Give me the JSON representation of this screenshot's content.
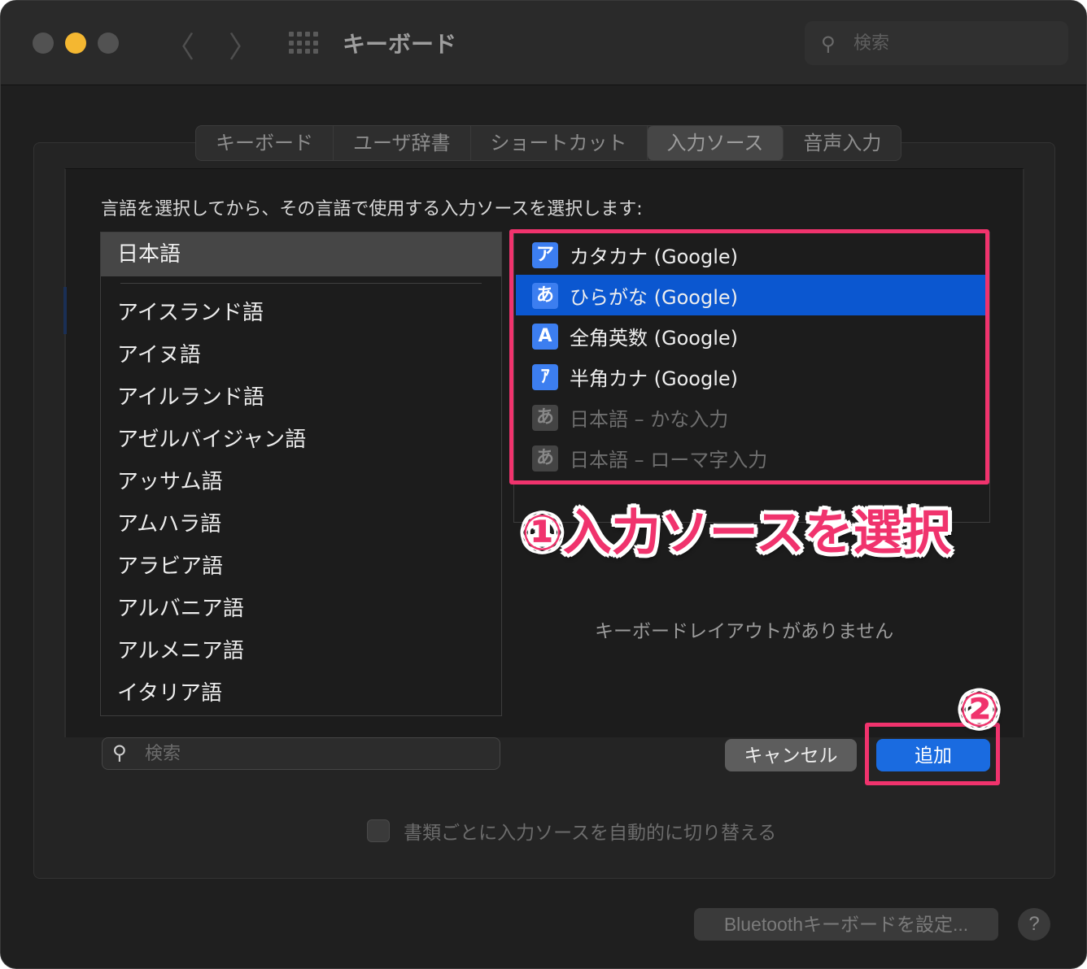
{
  "window": {
    "title": "キーボード",
    "search_placeholder": "検索",
    "nav_back_glyph": "〈",
    "nav_forward_glyph": "〉",
    "icons": [
      "traffic-light-close",
      "traffic-light-minimize",
      "traffic-light-zoom",
      "chevron-left-icon",
      "chevron-right-icon",
      "grid-icon",
      "search-icon"
    ]
  },
  "tabs": [
    {
      "label": "キーボード",
      "active": false
    },
    {
      "label": "ユーザ辞書",
      "active": false
    },
    {
      "label": "ショートカット",
      "active": false
    },
    {
      "label": "入力ソース",
      "active": true
    },
    {
      "label": "音声入力",
      "active": false
    }
  ],
  "sheet": {
    "instruction": "言語を選択してから、その言語で使用する入力ソースを選択します:",
    "languages": {
      "selected": "日本語",
      "items": [
        "アイスランド語",
        "アイヌ語",
        "アイルランド語",
        "アゼルバイジャン語",
        "アッサム語",
        "アムハラ語",
        "アラビア語",
        "アルバニア語",
        "アルメニア語",
        "イタリア語"
      ]
    },
    "input_sources": [
      {
        "icon": "ア",
        "label": "カタカナ (Google)",
        "selected": false,
        "dim": false
      },
      {
        "icon": "あ",
        "label": "ひらがな (Google)",
        "selected": true,
        "dim": false
      },
      {
        "icon": "A",
        "label": "全角英数 (Google)",
        "selected": false,
        "dim": false
      },
      {
        "icon": "ｱ",
        "label": "半角カナ (Google)",
        "selected": false,
        "dim": false
      },
      {
        "icon": "あ",
        "label": "日本語 – かな入力",
        "selected": false,
        "dim": true
      },
      {
        "icon": "あ",
        "label": "日本語 – ローマ字入力",
        "selected": false,
        "dim": true
      }
    ],
    "no_layout_message": "キーボードレイアウトがありません",
    "search_placeholder": "検索",
    "search_icon_glyph": "⚲",
    "cancel_label": "キャンセル",
    "add_label": "追加"
  },
  "footer": {
    "auto_switch_label": "書類ごとに入力ソースを自動的に切り替える",
    "auto_switch_checked": false,
    "bluetooth_label": "Bluetoothキーボードを設定...",
    "help_label": "?"
  },
  "annotations": {
    "step1": "①入力ソースを選択",
    "step2": "②",
    "highlight_color": "#f0336d"
  },
  "colors": {
    "accent": "#0b57d0",
    "add_button": "#1a6be0",
    "minimize_light": "#f4b731"
  }
}
